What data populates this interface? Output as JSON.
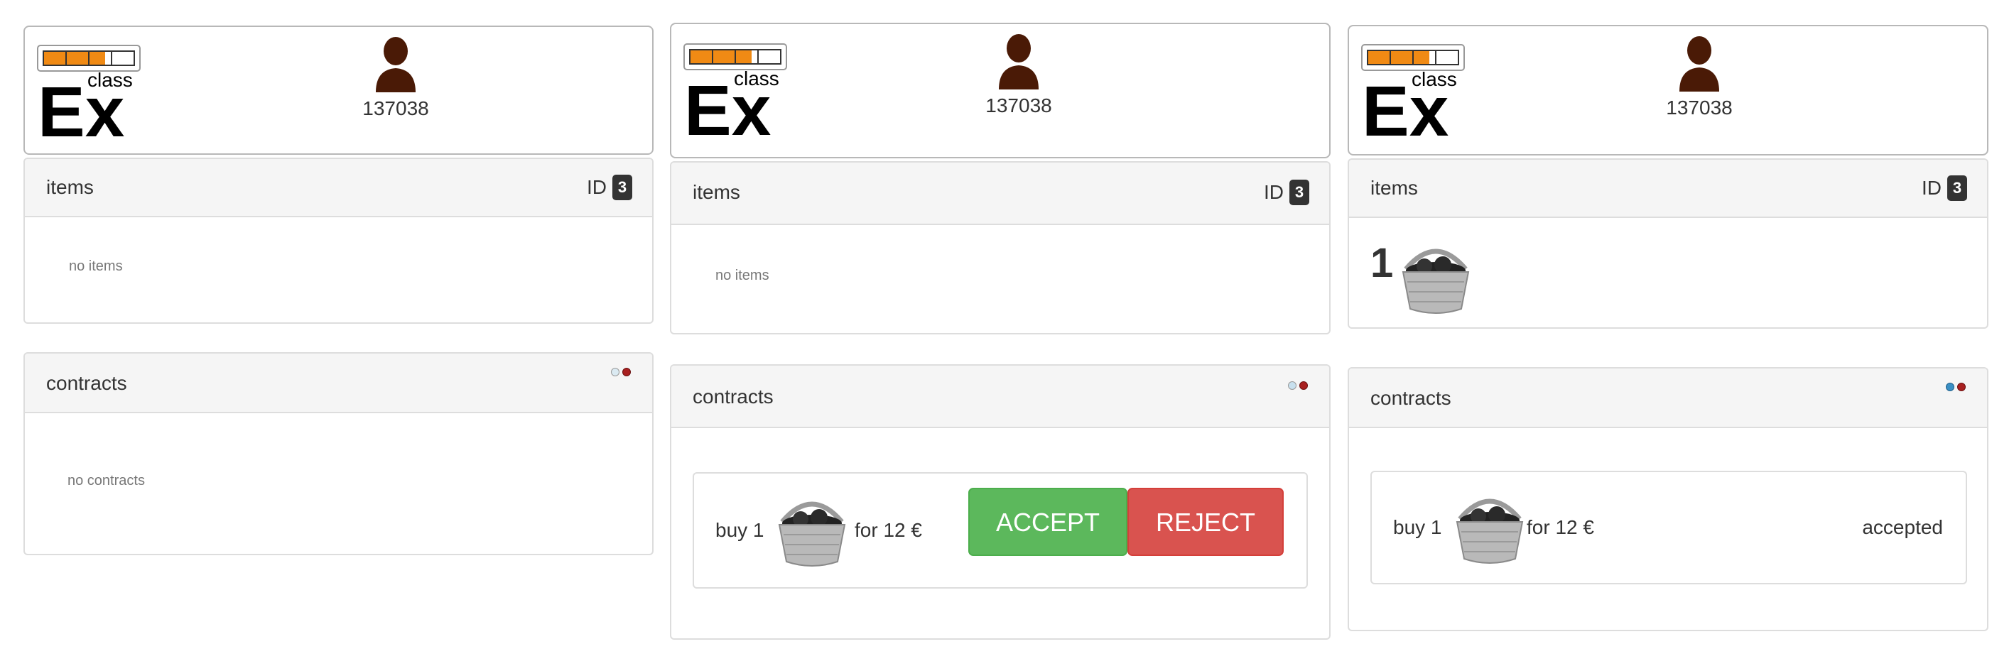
{
  "colors": {
    "accept": "#5cb85c",
    "reject": "#d9534f",
    "badge": "#333333",
    "panel_header": "#f5f5f5",
    "avatar": "#4a1a06",
    "logo_bar": "#f08a14"
  },
  "icons": {
    "logo": "classex-logo",
    "avatar": "person-silhouette-icon",
    "item": "basket-icon",
    "status_lights": "status-light-icons"
  },
  "columns": [
    {
      "logo_text": {
        "big": "Ex",
        "small": "class"
      },
      "user_id": "137038",
      "items": {
        "title": "items",
        "id_label": "ID",
        "id_value": "3",
        "empty_text": "no items"
      },
      "contracts": {
        "title": "contracts",
        "empty_text": "no contracts"
      }
    },
    {
      "logo_text": {
        "big": "Ex",
        "small": "class"
      },
      "user_id": "137038",
      "items": {
        "title": "items",
        "id_label": "ID",
        "id_value": "3",
        "empty_text": "no items"
      },
      "contracts": {
        "title": "contracts",
        "contract": {
          "buy": "buy 1",
          "for": "for 12 €",
          "accept": "ACCEPT",
          "reject": "REJECT"
        }
      }
    },
    {
      "logo_text": {
        "big": "Ex",
        "small": "class"
      },
      "user_id": "137038",
      "items": {
        "title": "items",
        "id_label": "ID",
        "id_value": "3",
        "count": "1"
      },
      "contracts": {
        "title": "contracts",
        "contract": {
          "buy": "buy 1",
          "for": "for 12 €",
          "status": "accepted"
        }
      }
    }
  ]
}
